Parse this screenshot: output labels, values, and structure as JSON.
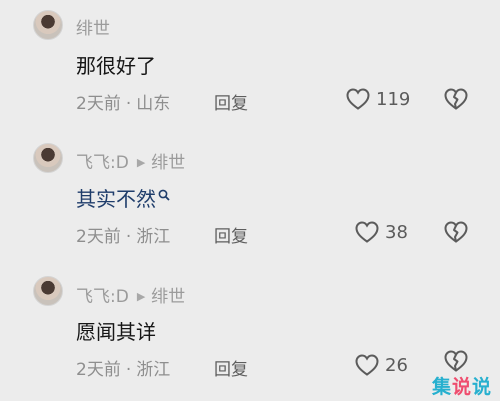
{
  "comments": [
    {
      "author": "绯世",
      "reply_to": "",
      "content": "那很好了",
      "time": "2天前",
      "location": "山东",
      "reply_label": "回复",
      "likes": "119"
    },
    {
      "author": "飞飞:D",
      "reply_to": "绯世",
      "content": "其实不然",
      "time": "2天前",
      "location": "浙江",
      "reply_label": "回复",
      "likes": "38"
    },
    {
      "author": "飞飞:D",
      "reply_to": "绯世",
      "content": "愿闻其详",
      "time": "2天前",
      "location": "浙江",
      "reply_label": "回复",
      "likes": "26"
    }
  ],
  "separator": "·",
  "icons": {
    "reply_arrow": "play-triangle-icon",
    "like": "heart-outline-icon",
    "dislike": "broken-heart-icon",
    "search": "search-icon"
  },
  "watermark": {
    "part1": "集",
    "part2": "说",
    "part3": "说"
  }
}
